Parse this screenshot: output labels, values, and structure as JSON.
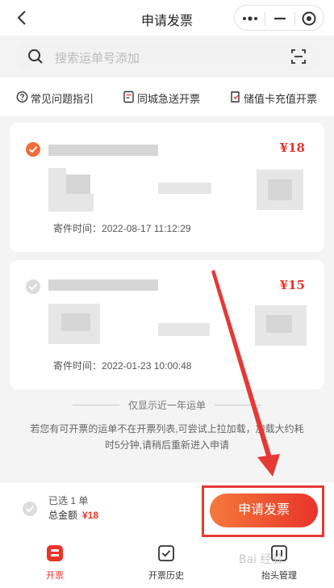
{
  "header": {
    "title": "申请发票"
  },
  "search": {
    "placeholder": "搜索运单号添加"
  },
  "links": [
    {
      "label": "常见问题指引",
      "icon": "question-icon"
    },
    {
      "label": "同城急送开票",
      "icon": "invoice-icon"
    },
    {
      "label": "储值卡充值开票",
      "icon": "card-icon"
    }
  ],
  "orders": [
    {
      "selected": true,
      "price": "¥18",
      "time_label": "寄件时间：",
      "time": "2022-08-17 11:12:29"
    },
    {
      "selected": false,
      "price": "¥15",
      "time_label": "寄件时间：",
      "time": "2022-01-23 10:00:48"
    }
  ],
  "divider": {
    "label": "仅显示近一年运单"
  },
  "notice": {
    "line1": "若您有可开票的运单不在开票列表,可尝试上拉加载，加载大约耗",
    "line2": "时5分钟,请稍后重新进入申请"
  },
  "summary": {
    "selected_text": "已选 1 单",
    "total_label": "总金额",
    "total_value": "¥18",
    "apply_button": "申请发票"
  },
  "tabs": [
    {
      "label": "开票",
      "icon": "invoice-tab-icon",
      "active": true
    },
    {
      "label": "开票历史",
      "icon": "history-icon",
      "active": false
    },
    {
      "label": "抬头管理",
      "icon": "title-manage-icon",
      "active": false
    }
  ],
  "watermark": "Bai 经验",
  "colors": {
    "accent": "#e8342a",
    "gradient_start": "#f47a3c",
    "annotation": "#e53935"
  }
}
